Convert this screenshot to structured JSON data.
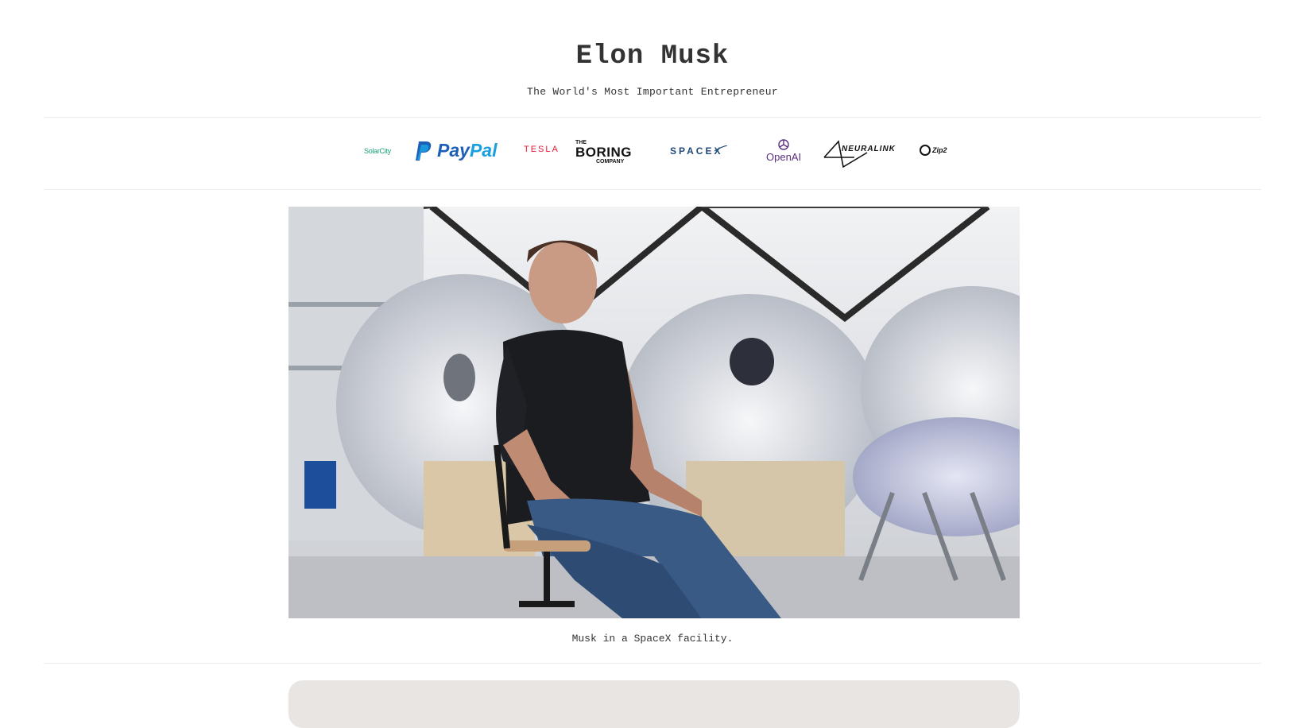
{
  "header": {
    "title": "Elon Musk",
    "subtitle": "The World's Most Important Entrepreneur"
  },
  "logos": {
    "solarcity": "SolarCity",
    "paypal_a": "Pay",
    "paypal_b": "Pal",
    "tesla": "TESLA",
    "boring_top": "THE",
    "boring_main": "BORING",
    "boring_bottom": "COMPANY",
    "spacex": "SPACEX",
    "openai": "OpenAI",
    "neuralink": "NEURALINK",
    "zip2": "Zip2"
  },
  "photo": {
    "caption": "Musk in a SpaceX facility."
  },
  "colors": {
    "solarcity": "#1aa37a",
    "paypal_dark": "#1d5fb6",
    "paypal_light": "#1aa0e0",
    "tesla": "#e31937",
    "spacex": "#1f4a78",
    "openai": "#5a2d82",
    "card": "#e8e5e3"
  }
}
